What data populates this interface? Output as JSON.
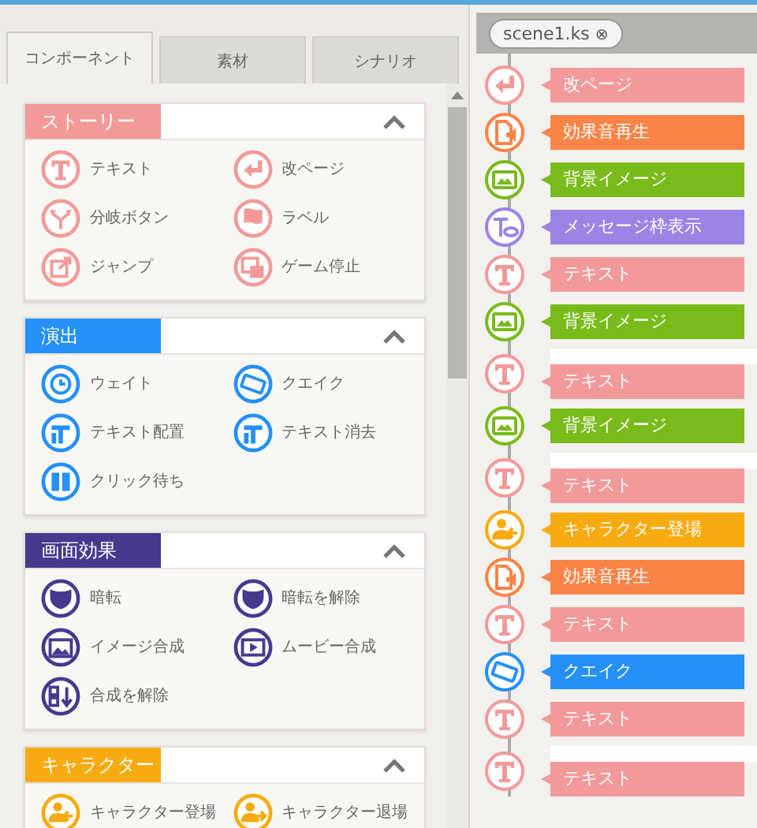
{
  "tabs": [
    {
      "label": "コンポーネント",
      "selected": true
    },
    {
      "label": "素材",
      "selected": false
    },
    {
      "label": "シナリオ",
      "selected": false
    }
  ],
  "sections": [
    {
      "title": "ストーリー",
      "color": "#f29a9a",
      "expanded": true,
      "items": [
        {
          "label": "テキスト",
          "kind": "text"
        },
        {
          "label": "改ページ",
          "kind": "page-break"
        },
        {
          "label": "分岐ボタン",
          "kind": "branch"
        },
        {
          "label": "ラベル",
          "kind": "label"
        },
        {
          "label": "ジャンプ",
          "kind": "jump"
        },
        {
          "label": "ゲーム停止",
          "kind": "stop"
        }
      ]
    },
    {
      "title": "演出",
      "color": "#2490f8",
      "expanded": true,
      "items": [
        {
          "label": "ウェイト",
          "kind": "wait"
        },
        {
          "label": "クエイク",
          "kind": "shake"
        },
        {
          "label": "テキスト配置",
          "kind": "text-place"
        },
        {
          "label": "テキスト消去",
          "kind": "text-clear"
        },
        {
          "label": "クリック待ち",
          "kind": "click-wait"
        }
      ]
    },
    {
      "title": "画面効果",
      "color": "#47398e",
      "expanded": true,
      "items": [
        {
          "label": "暗転",
          "kind": "fade"
        },
        {
          "label": "暗転を解除",
          "kind": "fade"
        },
        {
          "label": "イメージ合成",
          "kind": "image"
        },
        {
          "label": "ムービー合成",
          "kind": "movie"
        },
        {
          "label": "合成を解除",
          "kind": "unlayer"
        }
      ]
    },
    {
      "title": "キャラクター",
      "color": "#f8ab10",
      "expanded": true,
      "items": [
        {
          "label": "キャラクター登場",
          "kind": "char-in"
        },
        {
          "label": "キャラクター退場",
          "kind": "char-out"
        }
      ]
    }
  ],
  "file_tab": {
    "label": "scene1.ks",
    "close": "⊗"
  },
  "timeline": [
    {
      "label": "改ページ",
      "kind": "page-break",
      "color": "#f29a9a",
      "spaced": false
    },
    {
      "label": "効果音再生",
      "kind": "sound",
      "color": "#fa8447",
      "spaced": false
    },
    {
      "label": "背景イメージ",
      "kind": "bg",
      "color": "#79bb1b",
      "spaced": false
    },
    {
      "label": "メッセージ枠表示",
      "kind": "message",
      "color": "#9c84e5",
      "spaced": false
    },
    {
      "label": "テキスト",
      "kind": "text",
      "color": "#f29a9a",
      "spaced": false
    },
    {
      "label": "背景イメージ",
      "kind": "bg",
      "color": "#79bb1b",
      "spaced": false
    },
    {
      "label": "テキスト",
      "kind": "text",
      "color": "#f29a9a",
      "spaced": true
    },
    {
      "label": "背景イメージ",
      "kind": "bg",
      "color": "#79bb1b",
      "spaced": false
    },
    {
      "label": "テキスト",
      "kind": "text",
      "color": "#f29a9a",
      "spaced": true
    },
    {
      "label": "キャラクター登場",
      "kind": "char-in",
      "color": "#f8ab10",
      "spaced": false
    },
    {
      "label": "効果音再生",
      "kind": "sound",
      "color": "#fa8447",
      "spaced": false
    },
    {
      "label": "テキスト",
      "kind": "text",
      "color": "#f29a9a",
      "spaced": false
    },
    {
      "label": "クエイク",
      "kind": "shake",
      "color": "#2490f8",
      "spaced": false
    },
    {
      "label": "テキスト",
      "kind": "text",
      "color": "#f29a9a",
      "spaced": false
    },
    {
      "label": "テキスト",
      "kind": "text",
      "color": "#f29a9a",
      "spaced": true
    }
  ]
}
